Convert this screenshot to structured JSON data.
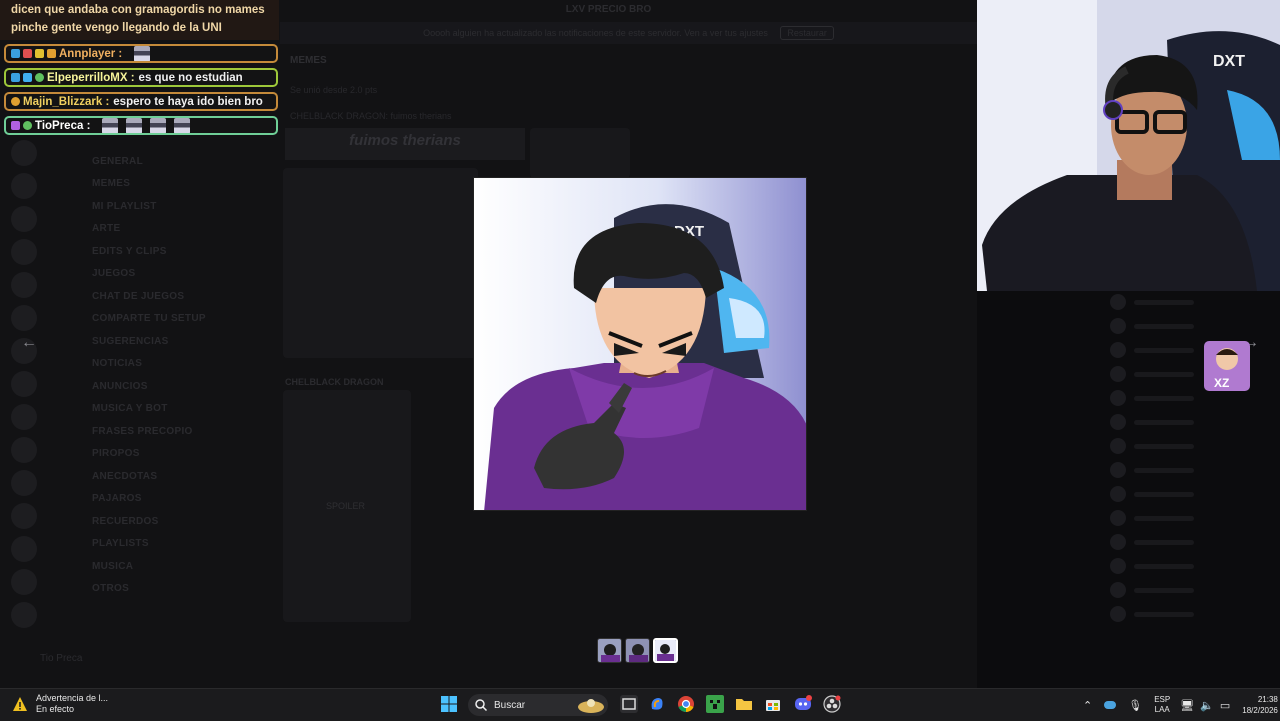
{
  "background": {
    "topbar_title": "LXV PRECIO BRO",
    "banner_text": "Ooooh alguien ha actualizado las notificaciones de este servidor. Ven a ver tus ajustes",
    "banner_button": "Restaurar",
    "channel_header": "MEMES",
    "line1": "Se unió desde 2.0 pts",
    "line2": "CHELBLACK DRAGON: fuimos therians",
    "card_title": "fuimos therians",
    "author": "CHELBLACK DRAGON",
    "spoiler_label": "SPOILER",
    "username": "Tio Preca",
    "channels": [
      "GENERAL",
      "MEMES",
      "MI PLAYLIST",
      "ARTE",
      "EDITS Y CLIPS",
      "JUEGOS",
      "CHAT DE JUEGOS",
      "COMPARTE TU SETUP",
      "SUGERENCIAS",
      "NOTICIAS",
      "ANUNCIOS",
      "MUSICA Y BOT",
      "FRASES PRECOPIO",
      "PIROPOS",
      "ANECDOTAS",
      "PAJAROS",
      "RECUERDOS",
      "PLAYLISTS",
      "MUSICA",
      "OTROS"
    ]
  },
  "chat": {
    "top_text_1": "dicen que andaba con gramagordis no mames",
    "top_text_2": "pinche gente vengo llegando de la UNI",
    "messages": [
      {
        "name": "Annplayer :",
        "text": "",
        "emotes": 1,
        "color": "#f0b060",
        "border": "#c48a3a"
      },
      {
        "name": "ElpeperrilloMX :",
        "text": "es que no estudian",
        "color": "#f5f39a",
        "border": "#9ec83a"
      },
      {
        "name": "Majin_Blizzark :",
        "text": "espero te haya ido bien bro",
        "color": "#f0d060",
        "border": "#c48a3a"
      },
      {
        "name": "TioPreca :",
        "text": "",
        "emotes": 4,
        "color": "#ffffff",
        "border": "#6fcf97"
      }
    ]
  },
  "viewer": {
    "prev_icon": "arrow-left",
    "next_icon": "arrow-right",
    "thumbnails": 3,
    "selected_thumbnail": 3
  },
  "webcam": {
    "chair_logo": "DXT"
  },
  "taskbar": {
    "weather_title": "Advertencia de l...",
    "weather_sub": "En efecto",
    "search_label": "Buscar",
    "lang_1": "ESP",
    "lang_2": "LAA",
    "time": "21:38",
    "date": "18/2/2026"
  }
}
